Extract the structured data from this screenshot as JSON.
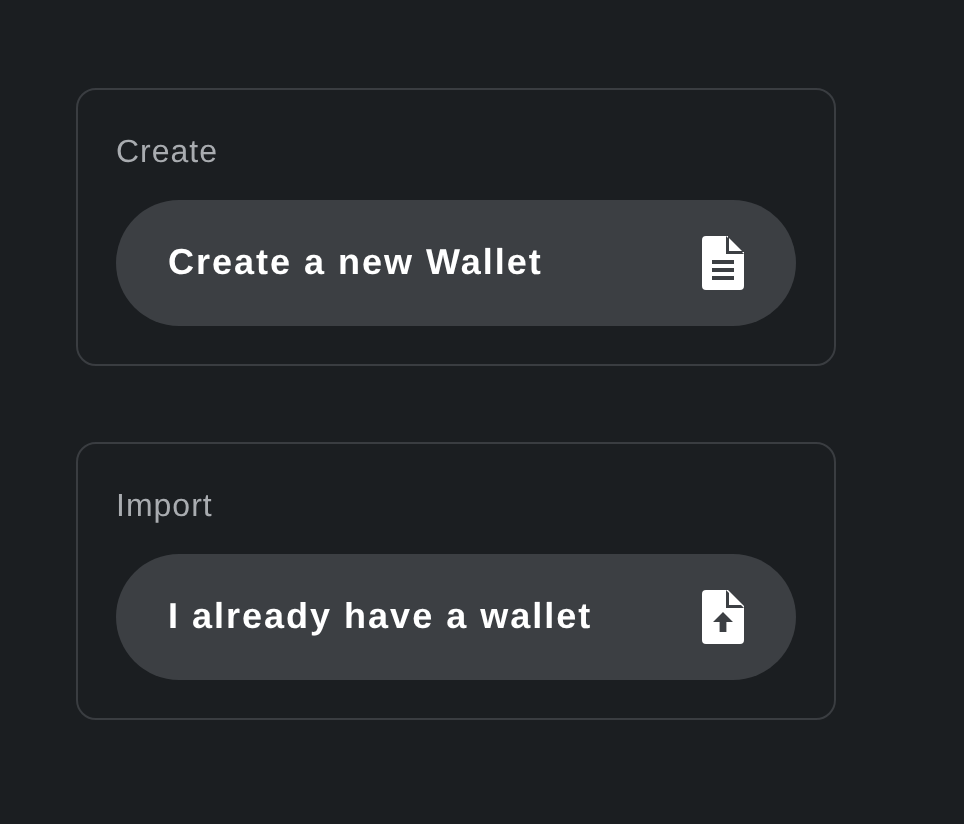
{
  "sections": [
    {
      "heading": "Create",
      "button": {
        "label": "Create a new Wallet",
        "kind": "new"
      }
    },
    {
      "heading": "Import",
      "button": {
        "label": "I already have a wallet",
        "kind": "import"
      }
    }
  ]
}
